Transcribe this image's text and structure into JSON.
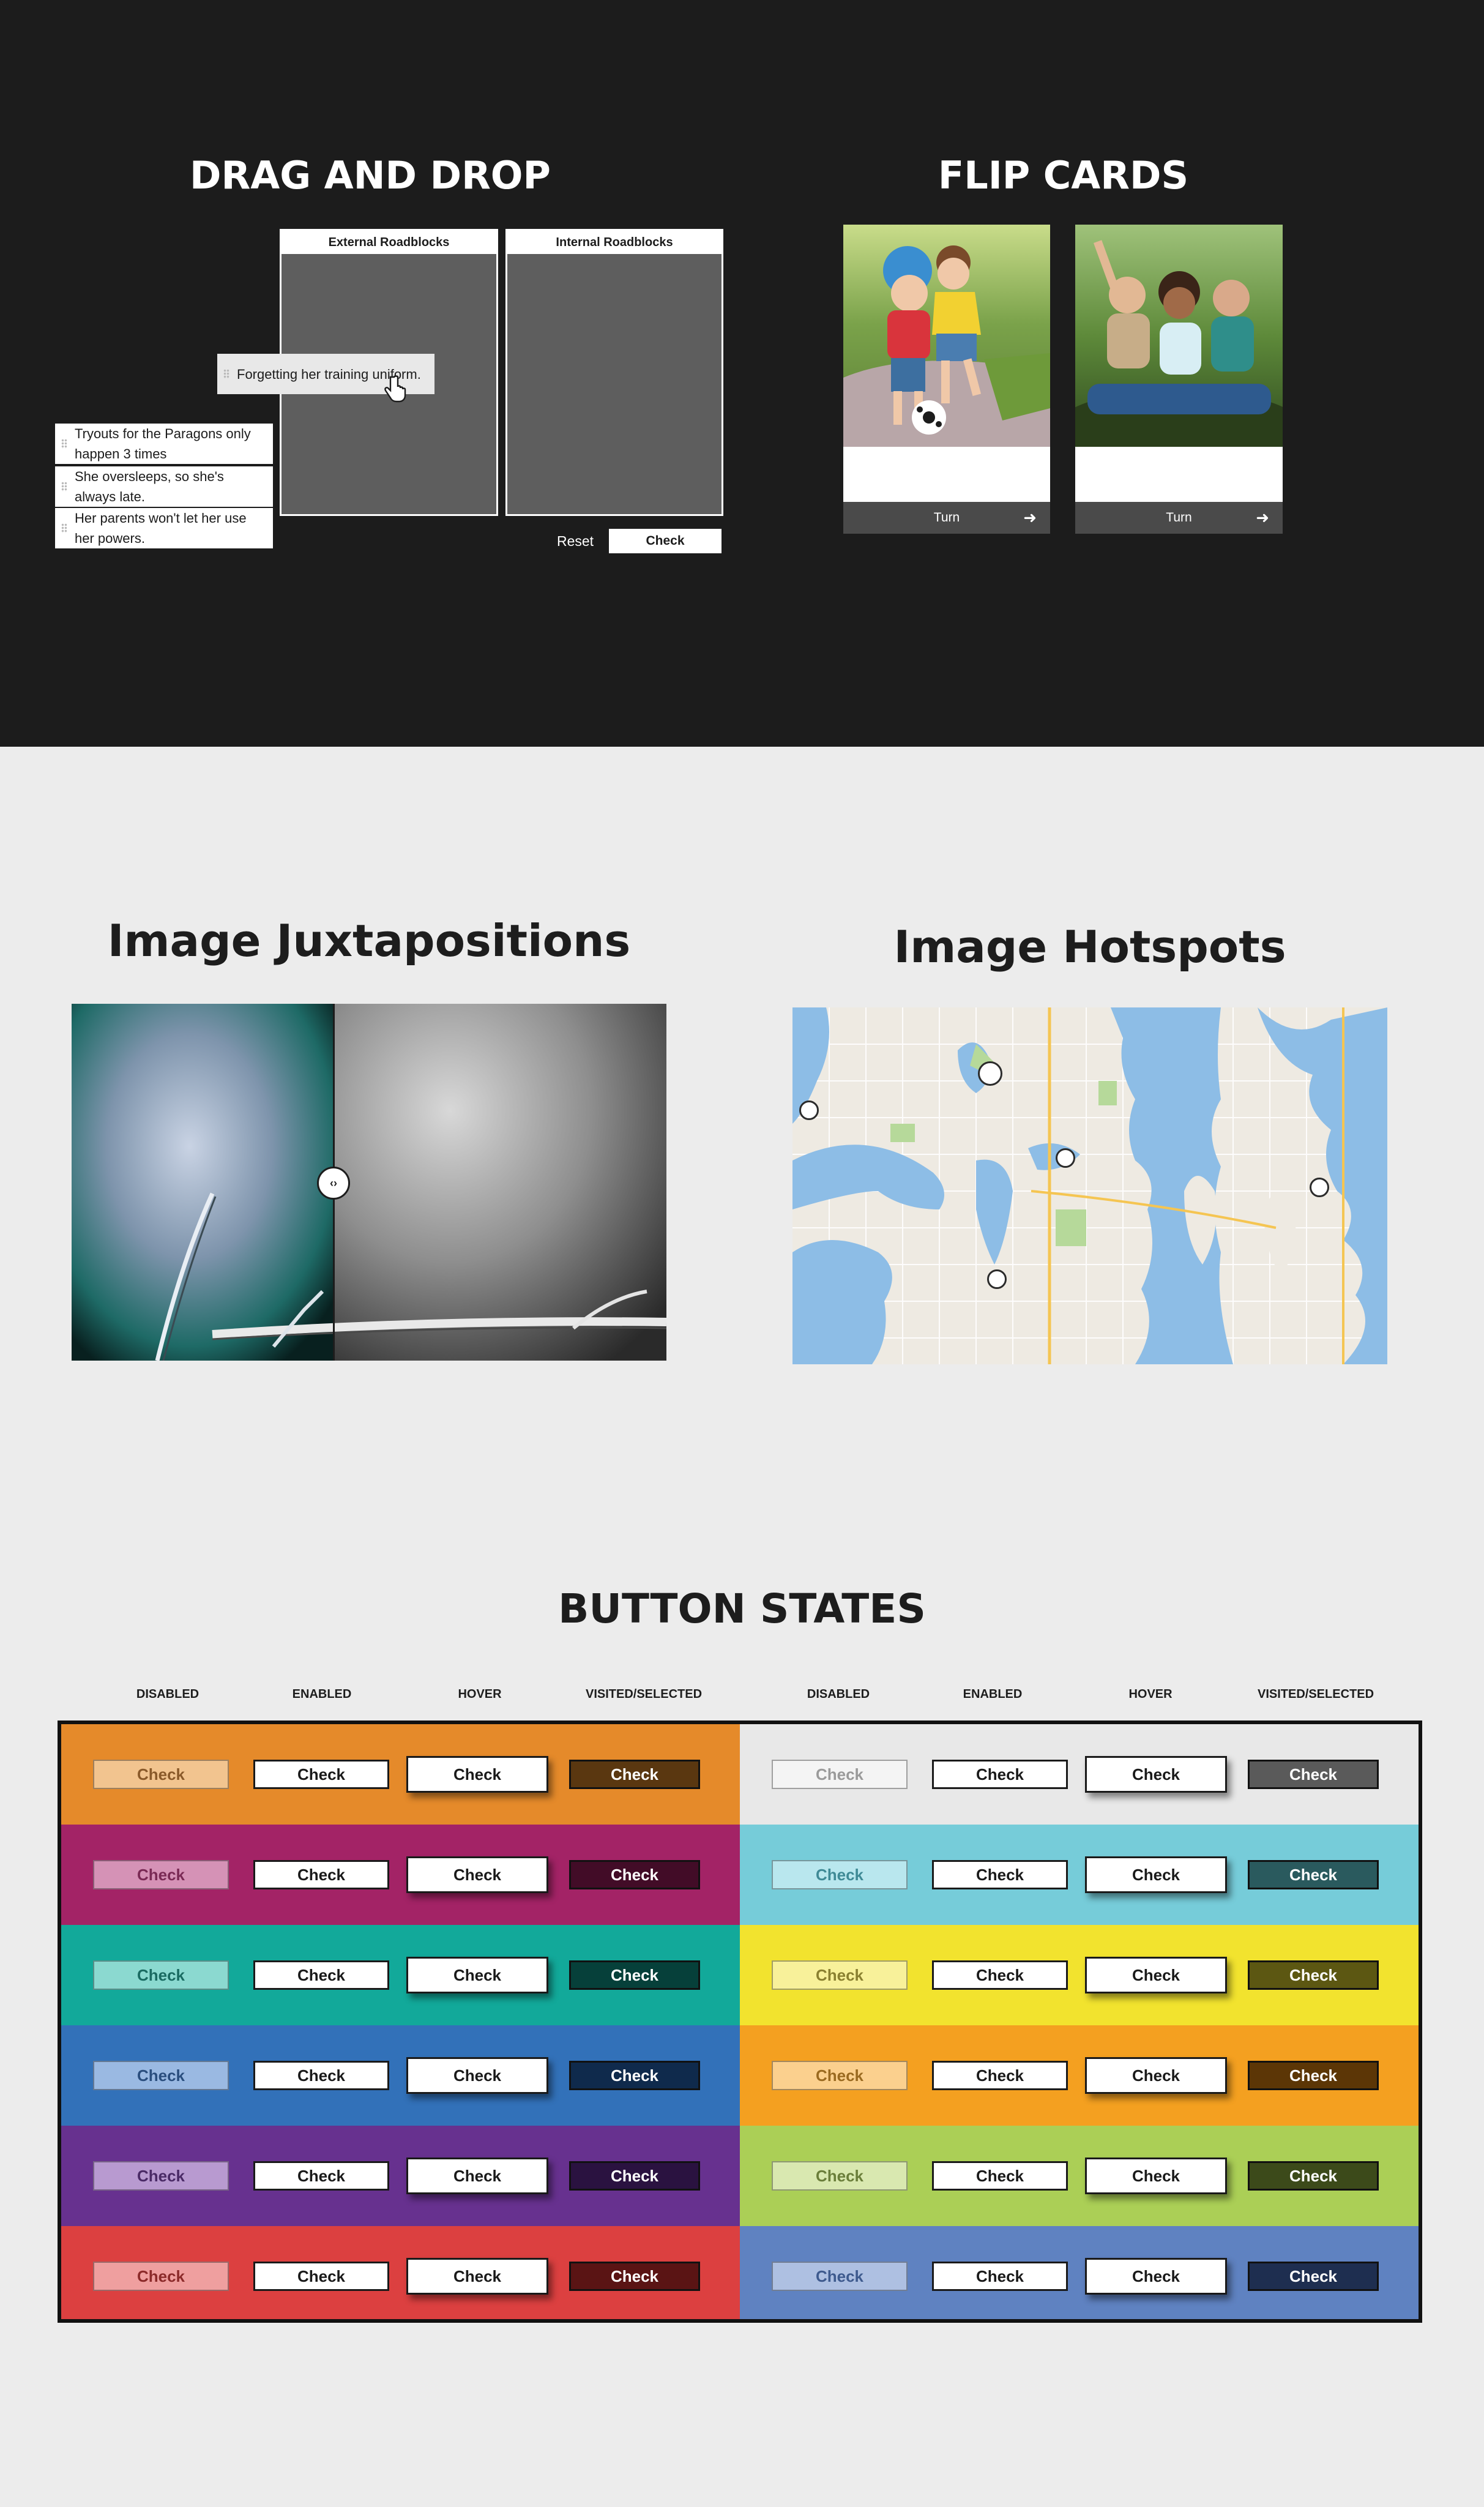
{
  "sections": {
    "drag_and_drop": {
      "title": "DRAG AND DROP",
      "zones": [
        "External Roadblocks",
        "Internal Roadblocks"
      ],
      "dragging_card": "Forgetting her training uniform.",
      "cards": [
        "Tryouts for the Paragons only happen 3 times",
        "She oversleeps, so she's always late.",
        "Her parents won't let her use her powers."
      ],
      "reset_label": "Reset",
      "check_label": "Check"
    },
    "flip_cards": {
      "title": "FLIP CARDS",
      "turn_label": "Turn"
    },
    "juxtapositions": {
      "title": "Image Juxtapositions"
    },
    "hotspots": {
      "title": "Image Hotspots"
    },
    "button_states": {
      "title": "BUTTON STATES",
      "column_headers": [
        "DISABLED",
        "ENABLED",
        "HOVER",
        "VISITED/SELECTED",
        "DISABLED",
        "ENABLED",
        "HOVER",
        "VISITED/SELECTED"
      ],
      "button_label": "Check",
      "left_palette": [
        {
          "bg": "#e58a2a",
          "disabled": "#f2c48f",
          "disabled_text": "#8a5a2a",
          "visited": "#5a3710"
        },
        {
          "bg": "#a32366",
          "disabled": "#d592b6",
          "disabled_text": "#7a2a55",
          "visited": "#420c27"
        },
        {
          "bg": "#12a99a",
          "disabled": "#8bd9d0",
          "disabled_text": "#1a6b62",
          "visited": "#06403a"
        },
        {
          "bg": "#3271b9",
          "disabled": "#9ab9e2",
          "disabled_text": "#2a4e7e",
          "visited": "#0f2a4c"
        },
        {
          "bg": "#67318f",
          "disabled": "#b89ad0",
          "disabled_text": "#4a2a66",
          "visited": "#2a1240"
        },
        {
          "bg": "#dc4040",
          "disabled": "#ef9f9f",
          "disabled_text": "#8c2a2a",
          "visited": "#5a1414"
        }
      ],
      "right_palette": [
        {
          "bg": "#e8e8e8",
          "disabled": "#f4f4f4",
          "disabled_text": "#9a9a9a",
          "visited": "#5a5a5a"
        },
        {
          "bg": "#76ccd9",
          "disabled": "#b9e7ee",
          "disabled_text": "#3f8a96",
          "visited": "#2a5a5e"
        },
        {
          "bg": "#f2e32e",
          "disabled": "#f8f19a",
          "disabled_text": "#8a8030",
          "visited": "#5c5712"
        },
        {
          "bg": "#f4a020",
          "disabled": "#fbd08e",
          "disabled_text": "#9a6a20",
          "visited": "#5c3606"
        },
        {
          "bg": "#abcf56",
          "disabled": "#d9e8b0",
          "disabled_text": "#6a7e3a",
          "visited": "#3c4a1a"
        },
        {
          "bg": "#5f82c1",
          "disabled": "#aec0e2",
          "disabled_text": "#3e5a8e",
          "visited": "#1e2e50"
        }
      ]
    }
  }
}
